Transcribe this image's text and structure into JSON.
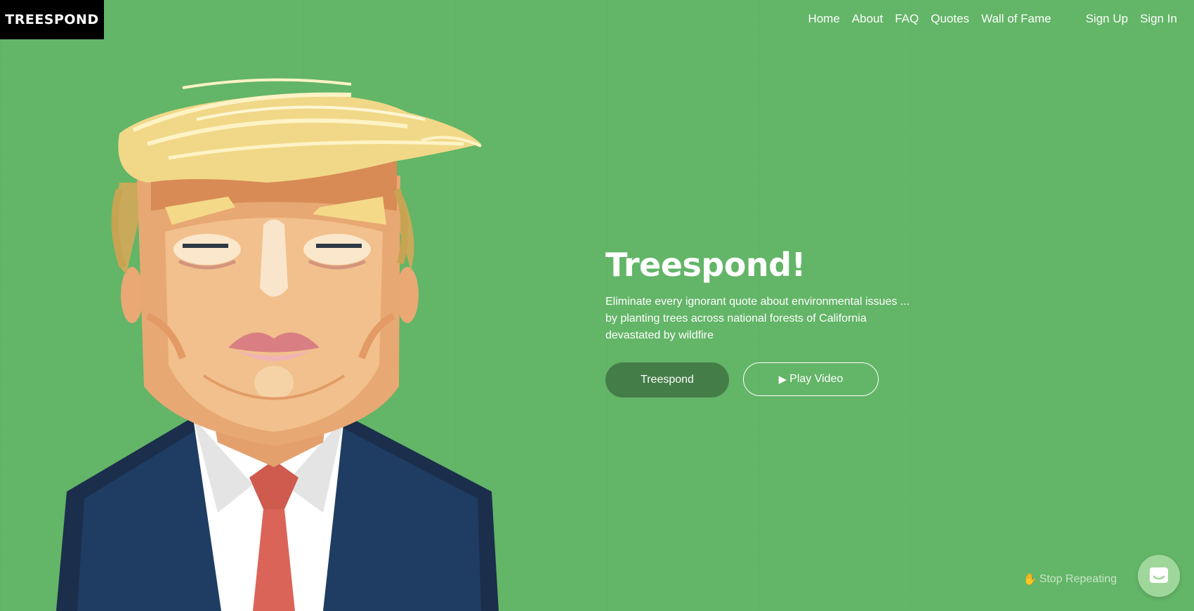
{
  "brand": {
    "logo_text": "TREESPOND"
  },
  "nav": {
    "items": [
      "Home",
      "About",
      "FAQ",
      "Quotes",
      "Wall of Fame"
    ],
    "auth": [
      "Sign Up",
      "Sign In"
    ]
  },
  "hero": {
    "title": "Treespond!",
    "description": "Eliminate every ignorant quote about environmental issues ...\nby planting trees across national forests of California\ndevastated by wildfire",
    "primary_button": "Treespond",
    "secondary_button": "Play Video",
    "illustration": "caricature-portrait-illustration"
  },
  "widgets": {
    "stop_repeating": "Stop Repeating",
    "chat_icon": "chat-icon"
  },
  "colors": {
    "background": "#63b567",
    "logo_bg": "#000000",
    "primary_button": "#447d48",
    "chat_button": "#9fd79b"
  }
}
